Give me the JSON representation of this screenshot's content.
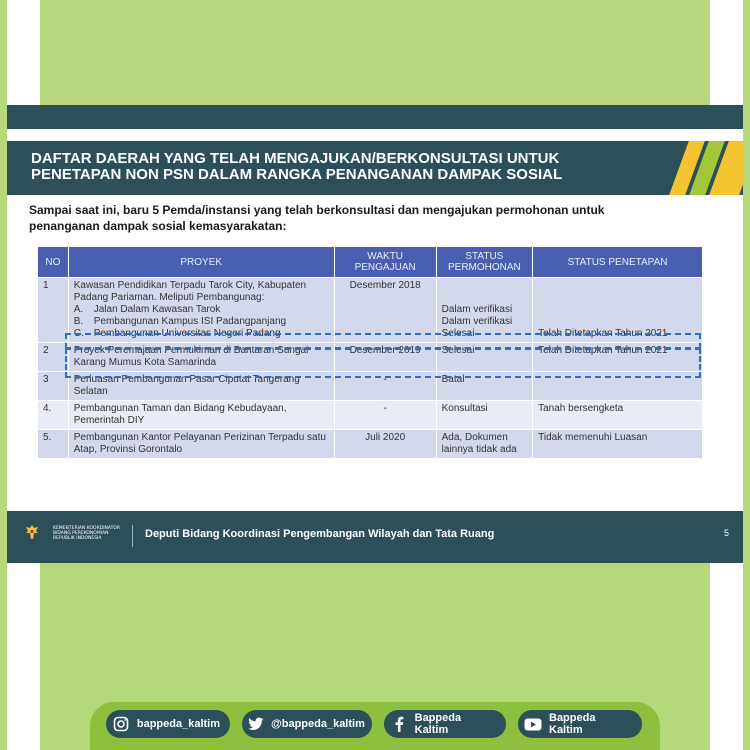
{
  "slide": {
    "title": "DAFTAR DAERAH YANG TELAH MENGAJUKAN/BERKONSULTASI UNTUK PENETAPAN NON PSN DALAM RANGKA PENANGANAN DAMPAK SOSIAL",
    "intro": "Sampai saat ini, baru 5 Pemda/instansi yang telah berkonsultasi dan mengajukan permohonan untuk penanganan dampak sosial kemasyarakatan:",
    "table": {
      "headers": [
        "NO",
        "PROYEK",
        "WAKTU PENGAJUAN",
        "STATUS PERMOHONAN",
        "STATUS PENETAPAN"
      ],
      "rows": [
        {
          "no": "1",
          "project": "Kawasan Pendidikan Terpadu Tarok City, Kabupaten Padang Pariaman. Meliputi Pembangunag:",
          "items": [
            {
              "marker": "A.",
              "text": "Jalan Dalam Kawasan Tarok"
            },
            {
              "marker": "B.",
              "text": "Pembangunan Kampus ISI Padangpanjang"
            },
            {
              "marker": "C.",
              "text": "Pembangunan Universitas Negeri Padang"
            }
          ],
          "time": "Desember 2018",
          "statuses": [
            "Dalam verifikasi",
            "Dalam verifikasi",
            "Selesai"
          ],
          "penetapan": "Telah Ditetapkan Tahun 2021"
        },
        {
          "no": "2",
          "project": "Proyek Peremajaan Permukiman di Bantaran Sungai Karang Mumus Kota Samarinda",
          "time": "Desember 2019",
          "status": "Selesai",
          "penetapan": "Telah Ditetapkan Tahun 2021"
        },
        {
          "no": "3",
          "project": "Perluasan Pembangunan Pasar Ciputat Tangerang Selatan",
          "time": "-",
          "status": "Batal",
          "penetapan": ""
        },
        {
          "no": "4.",
          "project": "Pembangunan Taman dan Bidang Kebudayaan, Pemerintah DIY",
          "time": "-",
          "status": "Konsultasi",
          "penetapan": "Tanah bersengketa"
        },
        {
          "no": "5.",
          "project": "Pembangunan Kantor Pelayanan Perizinan Terpadu satu Atap, Provinsi Gorontalo",
          "time": "Juli 2020",
          "status": "Ada, Dokumen lainnya tidak ada",
          "penetapan": "Tidak memenuhi Luasan"
        }
      ]
    },
    "footer": {
      "ministry_lines": [
        "KEMENTERIAN KOORDINATOR",
        "BIDANG PEREKONOMIAN",
        "REPUBLIK INDONESIA"
      ],
      "text": "Deputi Bidang Koordinasi Pengembangan Wilayah dan Tata Ruang",
      "page": "5"
    }
  },
  "social": [
    {
      "icon": "instagram-icon",
      "label": "bappeda_kaltim"
    },
    {
      "icon": "twitter-icon",
      "label": "@bappeda_kaltim"
    },
    {
      "icon": "facebook-icon",
      "label": "Bappeda Kaltim"
    },
    {
      "icon": "youtube-icon",
      "label": "Bappeda Kaltim"
    }
  ],
  "colors": {
    "background_green": "#b5d97a",
    "band_dark_teal": "#2c4f5a",
    "table_header_blue": "#4a5fb0",
    "accent_yellow": "#f4c430",
    "accent_green": "#a4c639",
    "highlight_dash_blue": "#2e6fc0"
  }
}
